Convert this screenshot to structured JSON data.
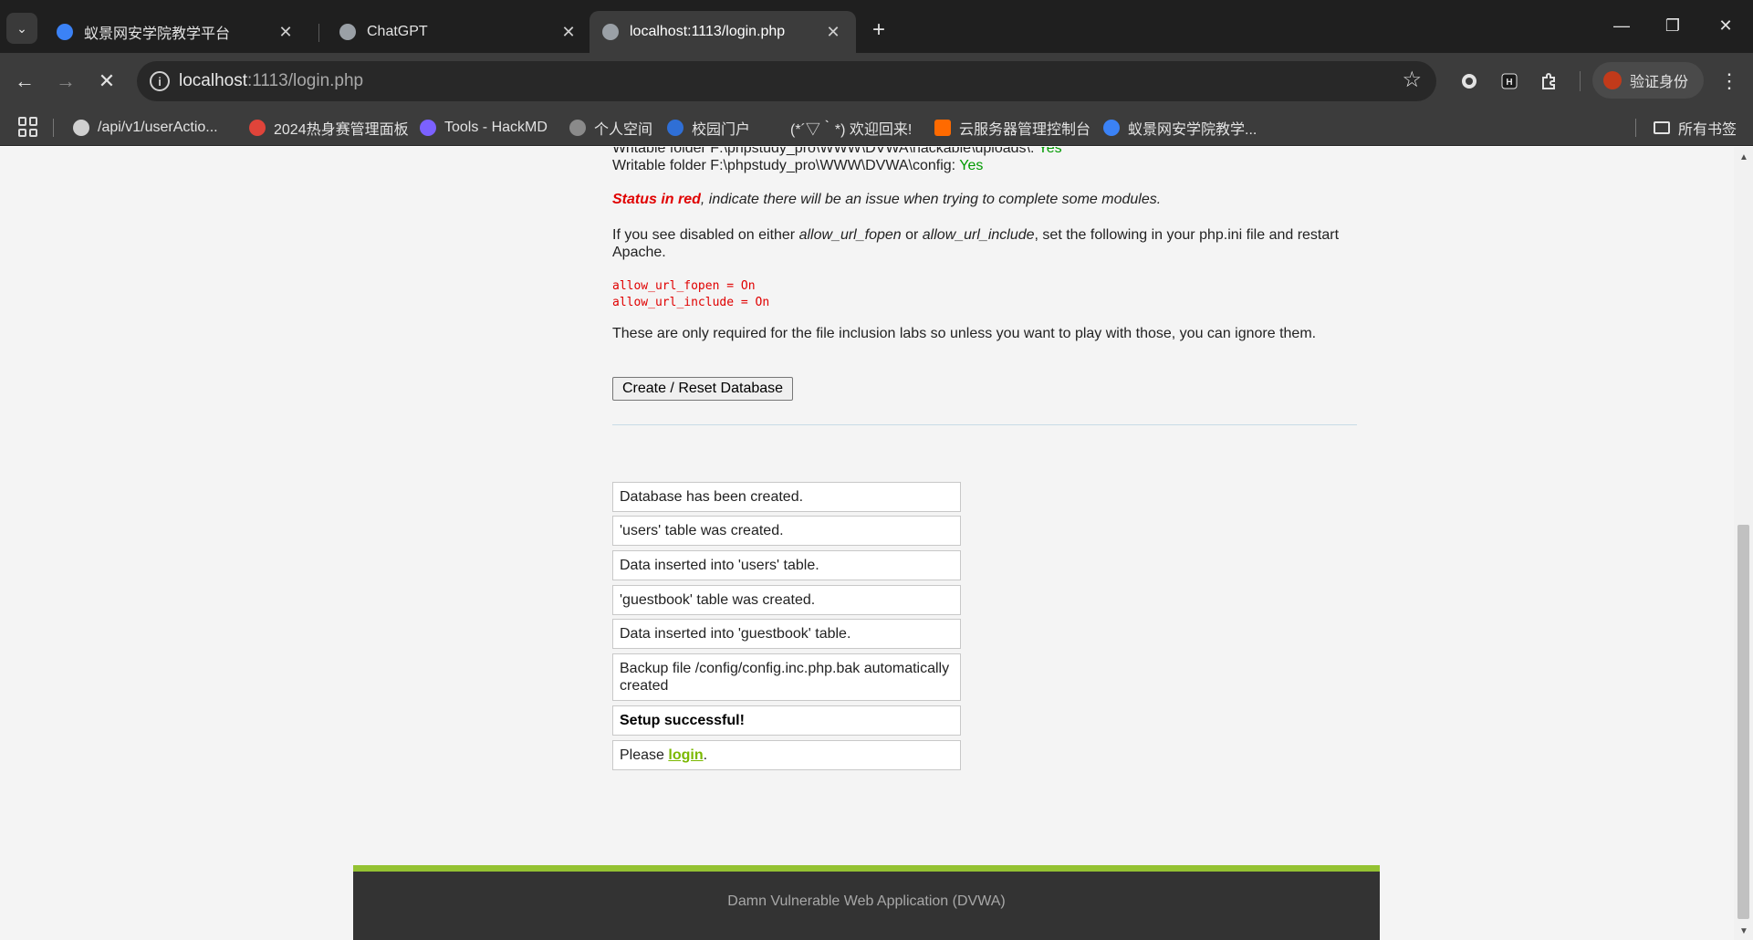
{
  "browser": {
    "tabs": [
      {
        "title": "蚁景网安学院教学平台",
        "favicon_color": "#3b82f6",
        "active": false
      },
      {
        "title": "ChatGPT",
        "favicon_color": "#9aa0a6",
        "active": false
      },
      {
        "title": "localhost:1113/login.php",
        "favicon_color": "#9aa0a6",
        "active": true
      }
    ],
    "tab_close_glyph": "✕",
    "new_tab_glyph": "+",
    "window": {
      "minimize": "—",
      "restore": "❐",
      "close": "✕"
    },
    "nav": {
      "back": "←",
      "forward": "→",
      "stop": "✕"
    },
    "url_host": "localhost",
    "url_path": ":1113/login.php",
    "profile_label": "验证身份",
    "bookmarks": [
      {
        "label": "/api/v1/userActio...",
        "icon_color": "#d0d0d0"
      },
      {
        "label": "2024热身赛管理面板",
        "icon_color": "#e0443a"
      },
      {
        "label": "Tools - HackMD",
        "icon_color": "#7b61ff"
      },
      {
        "label": "个人空间",
        "icon_color": "#8a8a8a"
      },
      {
        "label": "校园门户",
        "icon_color": "#2f6fd6"
      },
      {
        "label": "(*´▽｀*) 欢迎回来!",
        "icon_color": "#3c3c3c"
      },
      {
        "label": "云服务器管理控制台",
        "icon_color": "#ff6a00"
      },
      {
        "label": "蚁景网安学院教学...",
        "icon_color": "#3b82f6"
      }
    ],
    "all_bookmarks_label": "所有书签"
  },
  "page": {
    "writable_uploads_prefix": "Writable folder F:\\phpstudy_pro\\WWW\\DVWA\\hackable\\uploads\\: ",
    "writable_config_prefix": "Writable folder F:\\phpstudy_pro\\WWW\\DVWA\\config: ",
    "yes": "Yes",
    "status_red": "Status in red",
    "status_red_rest": ", indicate there will be an issue when trying to complete some modules.",
    "disabled_pre": "If you see disabled on either ",
    "allow_url_fopen": "allow_url_fopen",
    "or": " or ",
    "allow_url_include": "allow_url_include",
    "disabled_post": ", set the following in your php.ini file and restart",
    "apache": "Apache.",
    "code_line1": "allow_url_fopen = On",
    "code_line2": "allow_url_include = On",
    "inclusion_note": "These are only required for the file inclusion labs so unless you want to play with those, you can ignore them.",
    "reset_button": "Create / Reset Database",
    "messages": [
      "Database has been created.",
      "'users' table was created.",
      "Data inserted into 'users' table.",
      "'guestbook' table was created.",
      "Data inserted into 'guestbook' table.",
      "Backup file /config/config.inc.php.bak automatically created"
    ],
    "setup_success": "Setup successful!",
    "please": "Please ",
    "login_link": "login",
    "period": ".",
    "footer": "Damn Vulnerable Web Application (DVWA)"
  },
  "colors": {
    "ok_green": "#009900",
    "warn_red": "#e00000",
    "link_green": "#7ab800",
    "footer_bar": "#94c232"
  }
}
